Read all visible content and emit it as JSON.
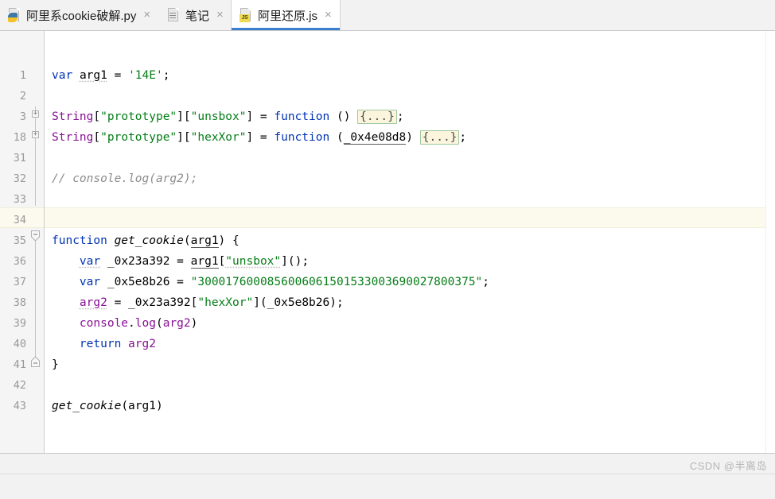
{
  "window": {
    "app": "jetbrains-ide",
    "accent_color": "#3c7fd0",
    "background": "#ffffff"
  },
  "tabs": [
    {
      "label": "阿里系cookie破解.py",
      "icon": "python-file-icon",
      "active": false,
      "close_glyph": "×"
    },
    {
      "label": "笔记",
      "icon": "text-file-icon",
      "active": false,
      "close_glyph": "×"
    },
    {
      "label": "阿里还原.js",
      "icon": "javascript-file-icon",
      "active": true,
      "close_glyph": "×"
    }
  ],
  "editor": {
    "language": "JavaScript",
    "current_line_number": "34",
    "gutter": {
      "line_numbers": [
        "1",
        "2",
        "3",
        "18",
        "31",
        "32",
        "33",
        "34",
        "35",
        "36",
        "37",
        "38",
        "39",
        "40",
        "41",
        "42",
        "43"
      ]
    },
    "folded_placeholder": "{...}",
    "lines": [
      {
        "n": "1",
        "text": "var arg1 = '14E';"
      },
      {
        "n": "2",
        "text": ""
      },
      {
        "n": "3",
        "text": "String[\"prototype\"][\"unsbox\"] = function () {...};"
      },
      {
        "n": "18",
        "text": "String[\"prototype\"][\"hexXor\"] = function (_0x4e08d8) {...};"
      },
      {
        "n": "31",
        "text": ""
      },
      {
        "n": "32",
        "text": "// console.log(arg2);"
      },
      {
        "n": "33",
        "text": ""
      },
      {
        "n": "34",
        "text": ""
      },
      {
        "n": "35",
        "text": "function get_cookie(arg1) {"
      },
      {
        "n": "36",
        "text": "    var _0x23a392 = arg1[\"unsbox\"]();"
      },
      {
        "n": "37",
        "text": "    var _0x5e8b26 = \"3000176000856006061501533003690027800375\";"
      },
      {
        "n": "38",
        "text": "    arg2 = _0x23a392[\"hexXor\"](_0x5e8b26);"
      },
      {
        "n": "39",
        "text": "    console.log(arg2)"
      },
      {
        "n": "40",
        "text": "    return arg2"
      },
      {
        "n": "41",
        "text": "}"
      },
      {
        "n": "42",
        "text": ""
      },
      {
        "n": "43",
        "text": "get_cookie(arg1)"
      }
    ],
    "tokens": {
      "var": "var",
      "function": "function",
      "return": "return",
      "arg1": "arg1",
      "arg2": "arg2",
      "string_obj": "String",
      "prototype_key": "\"prototype\"",
      "unsbox_key": "\"unsbox\"",
      "hexxor_key": "\"hexXor\"",
      "param_0x4e08d8": "_0x4e08d8",
      "var_0x23a392": "_0x23a392",
      "var_0x5e8b26": "_0x5e8b26",
      "hex_string": "\"3000176000856006061501533003690027800375\"",
      "arg1_value": "'14E'",
      "fn_name": "get_cookie",
      "console": "console",
      "log": "log",
      "comment": "// console.log(arg2);"
    },
    "colors": {
      "keyword": "#0033b3",
      "string": "#067d17",
      "number": "#1750eb",
      "property": "#871094",
      "comment": "#8c8c8c",
      "plain": "#000000",
      "current_line_bg": "#fcfaed",
      "fold_chip_bg": "#faf5dc",
      "fold_chip_border": "#9fc89f",
      "gutter_bg": "#f5f5f5",
      "line_number": "#999999"
    }
  },
  "status": {
    "watermark": "CSDN @半离岛"
  }
}
